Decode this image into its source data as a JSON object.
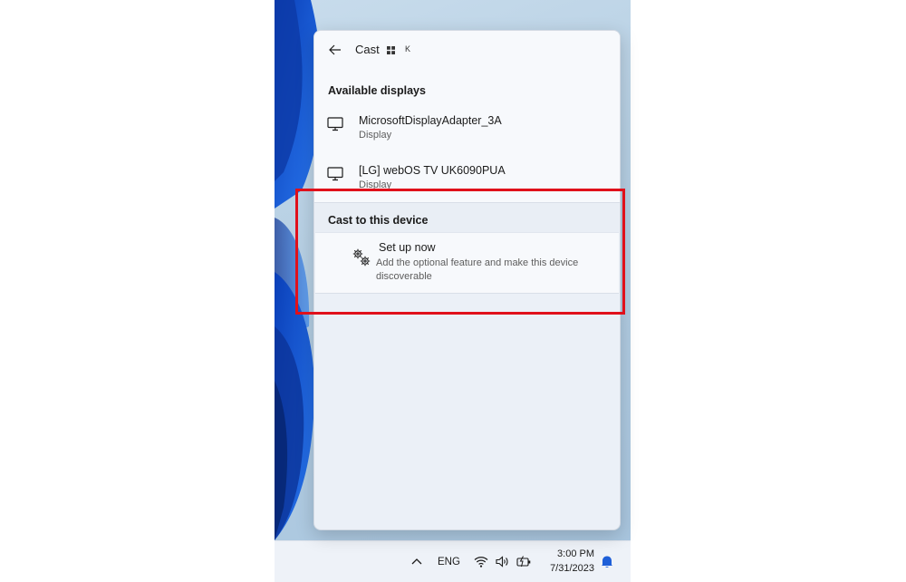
{
  "panel": {
    "back_icon": "back-arrow-icon",
    "title": "Cast",
    "grid_icon": "grid-icon",
    "shortcut_key": "K"
  },
  "available_displays": {
    "heading": "Available displays",
    "devices": [
      {
        "name": "MicrosoftDisplayAdapter_3A",
        "type": "Display",
        "icon": "monitor-icon"
      },
      {
        "name": "[LG] webOS TV UK6090PUA",
        "type": "Display",
        "icon": "monitor-icon"
      }
    ]
  },
  "cast_to_device": {
    "heading": "Cast to this device",
    "setup": {
      "icon": "gears-icon",
      "title": "Set up now",
      "description": "Add the optional feature and make this device discoverable"
    }
  },
  "taskbar": {
    "language": "ENG",
    "time": "3:00 PM",
    "date": "7/31/2023"
  },
  "colors": {
    "highlight": "#e0101b",
    "panel_bg": "#ebf0f7",
    "wallpaper_blue": "#1e5fd8"
  }
}
